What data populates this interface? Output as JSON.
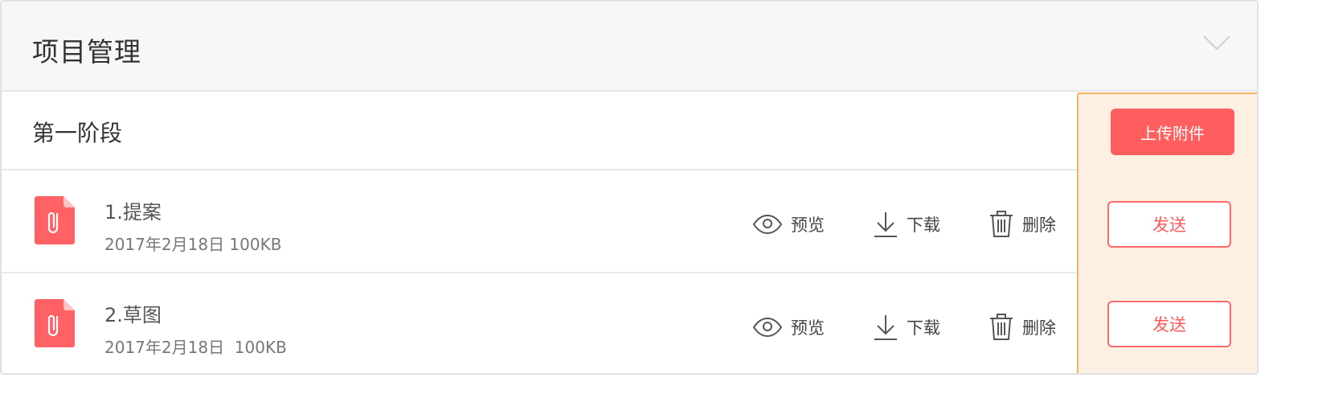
{
  "panel": {
    "title": "项目管理",
    "stage": {
      "title": "第一阶段",
      "upload_label": "上传附件"
    },
    "files": [
      {
        "name": "1.提案",
        "meta": "2017年2月18日 100KB",
        "preview_label": "预览",
        "download_label": "下载",
        "delete_label": "删除",
        "send_label": "发送"
      },
      {
        "name": "2.草图",
        "meta": "2017年2月18日  100KB",
        "preview_label": "预览",
        "download_label": "下载",
        "delete_label": "删除",
        "send_label": "发送"
      }
    ]
  },
  "colors": {
    "accent": "#ff5e5e",
    "highlight_bg": "#fdefe1",
    "highlight_border": "#f6b266",
    "header_bg": "#f7f7f7"
  },
  "icons": {
    "expand": "chevron-down-icon",
    "file": "paperclip-file-icon",
    "preview": "eye-icon",
    "download": "download-icon",
    "delete": "trash-icon"
  }
}
